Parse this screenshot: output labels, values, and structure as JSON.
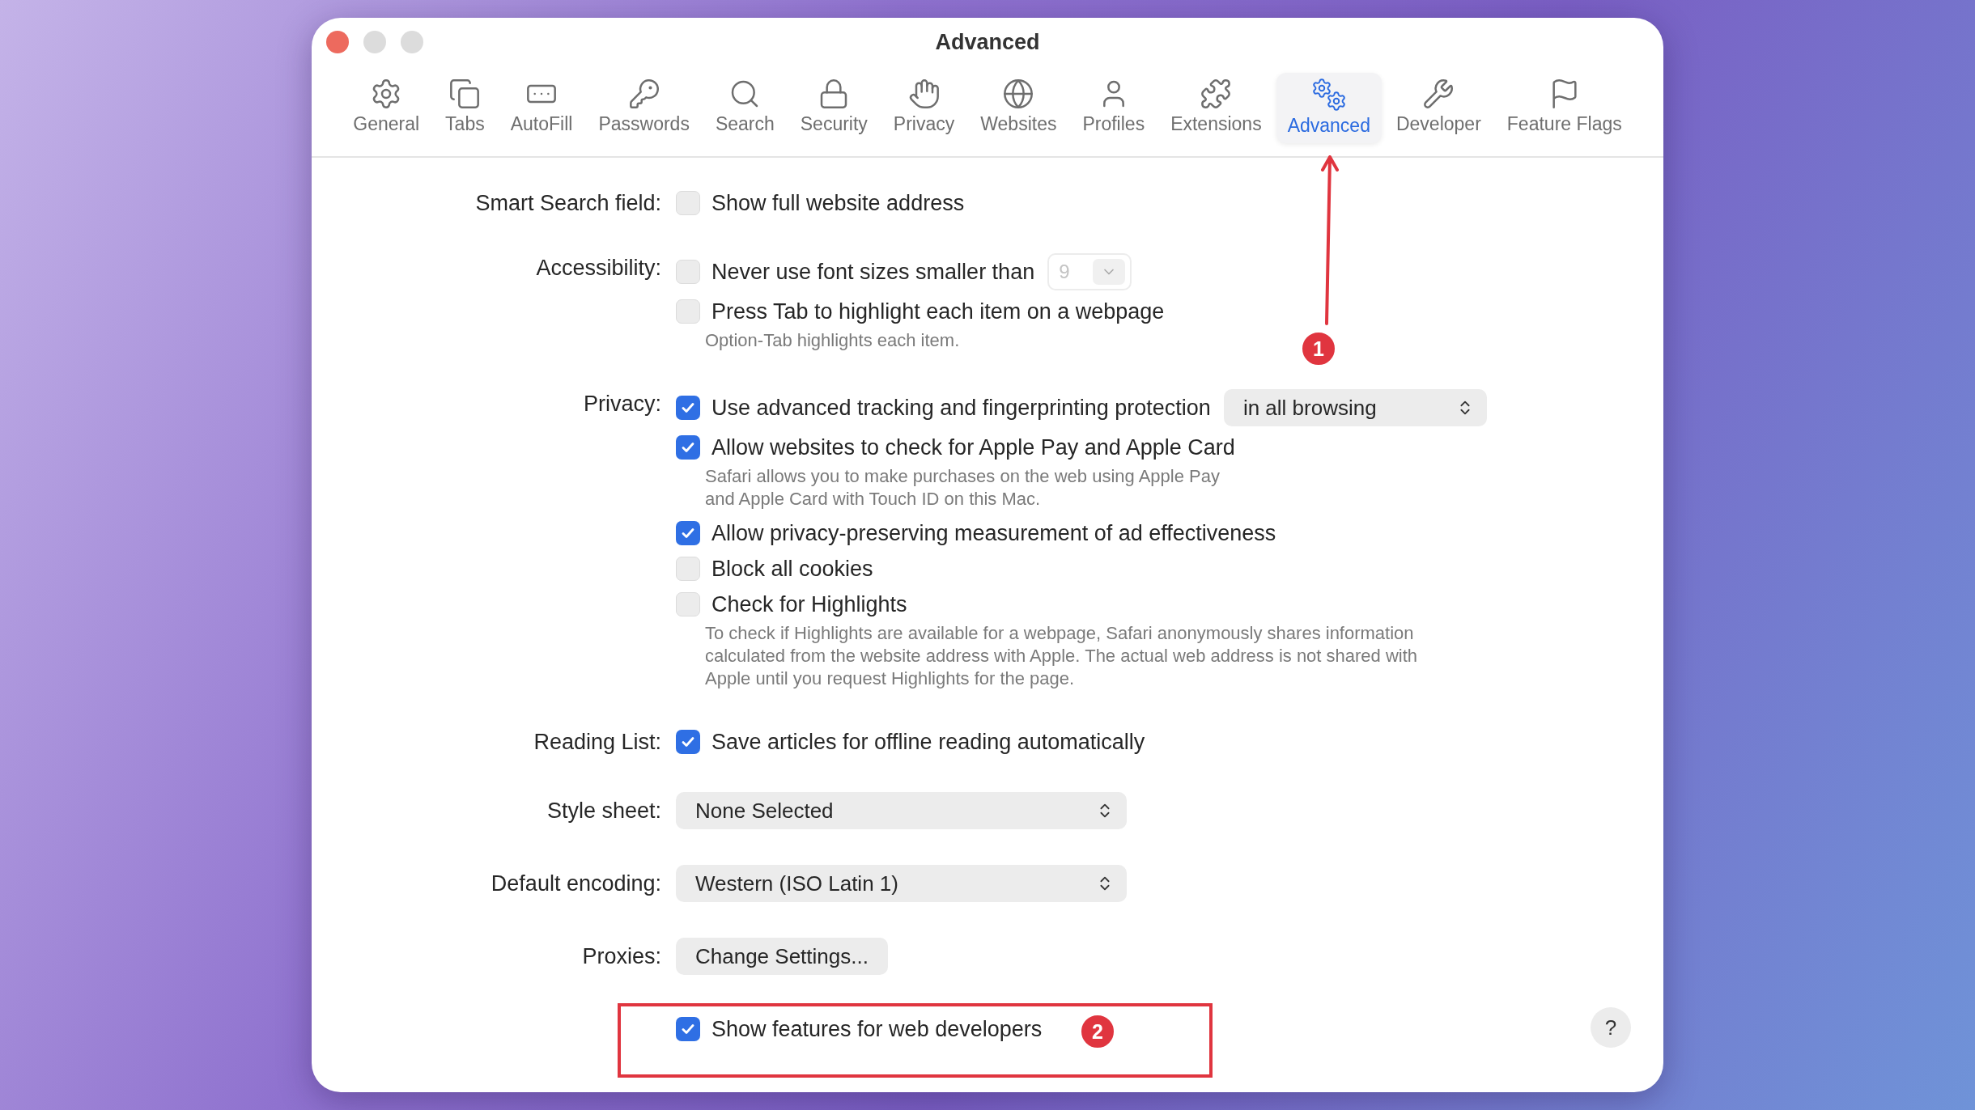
{
  "window": {
    "title": "Advanced"
  },
  "tabs": [
    {
      "label": "General",
      "selected": false
    },
    {
      "label": "Tabs",
      "selected": false
    },
    {
      "label": "AutoFill",
      "selected": false
    },
    {
      "label": "Passwords",
      "selected": false
    },
    {
      "label": "Search",
      "selected": false
    },
    {
      "label": "Security",
      "selected": false
    },
    {
      "label": "Privacy",
      "selected": false
    },
    {
      "label": "Websites",
      "selected": false
    },
    {
      "label": "Profiles",
      "selected": false
    },
    {
      "label": "Extensions",
      "selected": false
    },
    {
      "label": "Advanced",
      "selected": true
    },
    {
      "label": "Developer",
      "selected": false
    },
    {
      "label": "Feature Flags",
      "selected": false
    }
  ],
  "sections": [
    {
      "label": "Smart Search field:",
      "items": [
        {
          "kind": "checkbox",
          "label": "Show full website address",
          "checked": false
        }
      ]
    },
    {
      "label": "Accessibility:",
      "items": [
        {
          "kind": "checkbox",
          "label": "Never use font sizes smaller than",
          "checked": false,
          "size_menu": {
            "value": "9",
            "disabled": true
          }
        },
        {
          "kind": "checkbox",
          "label": "Press Tab to highlight each item on a webpage",
          "checked": false,
          "hint": "Option-Tab highlights each item."
        }
      ]
    },
    {
      "label": "Privacy:",
      "items": [
        {
          "kind": "checkbox",
          "label": "Use advanced tracking and fingerprinting protection",
          "checked": true,
          "menu": {
            "value": "in all browsing"
          }
        },
        {
          "kind": "checkbox",
          "label": "Allow websites to check for Apple Pay and Apple Card",
          "checked": true,
          "hint": "Safari allows you to make purchases on the web using Apple Pay\nand Apple Card with Touch ID on this Mac."
        },
        {
          "kind": "checkbox",
          "label": "Allow privacy-preserving measurement of ad effectiveness",
          "checked": true
        },
        {
          "kind": "checkbox",
          "label": "Block all cookies",
          "checked": false
        },
        {
          "kind": "checkbox",
          "label": "Check for Highlights",
          "checked": false,
          "hint": "To check if Highlights are available for a webpage, Safari anonymously shares information\ncalculated from the website address with Apple. The actual web address is not shared with\nApple until you request Highlights for the page."
        }
      ]
    },
    {
      "label": "Reading List:",
      "items": [
        {
          "kind": "checkbox",
          "label": "Save articles for offline reading automatically",
          "checked": true
        }
      ]
    },
    {
      "label": "Style sheet:",
      "items": [
        {
          "kind": "popup",
          "value": "None Selected"
        }
      ]
    },
    {
      "label": "Default encoding:",
      "items": [
        {
          "kind": "popup",
          "value": "Western (ISO Latin 1)"
        }
      ]
    },
    {
      "label": "Proxies:",
      "items": [
        {
          "kind": "button",
          "label": "Change Settings..."
        }
      ]
    },
    {
      "items": [
        {
          "kind": "checkbox",
          "label": "Show features for web developers",
          "checked": true
        }
      ]
    }
  ],
  "help_button": {
    "label": "?"
  },
  "annotations": [
    {
      "kind": "arrow_badge",
      "label": "1"
    },
    {
      "kind": "box_badge",
      "label": "2"
    }
  ]
}
